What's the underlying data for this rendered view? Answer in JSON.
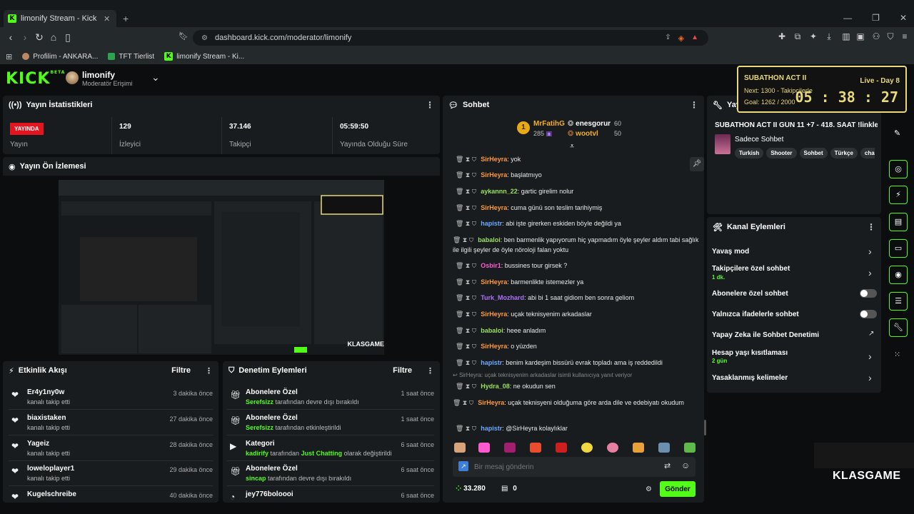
{
  "browser": {
    "tab_title": "limonify Stream - Kick Dashboard",
    "url": "dashboard.kick.com/moderator/limonify",
    "bookmarks": [
      "Profilim - ANKARA...",
      "TFT Tierlist",
      "limonify Stream - Ki..."
    ]
  },
  "header": {
    "logo": "KICK",
    "logo_beta": "BETA",
    "channel_name": "limonify",
    "channel_role": "Moderatör Erişimi"
  },
  "stats": {
    "title": "Yayın İstatistikleri",
    "live_badge": "YAYINDA",
    "items": [
      {
        "value": "",
        "label": "Yayın"
      },
      {
        "value": "129",
        "label": "İzleyici"
      },
      {
        "value": "37.146",
        "label": "Takipçi"
      },
      {
        "value": "05:59:50",
        "label": "Yayında Olduğu Süre"
      }
    ]
  },
  "preview": {
    "title": "Yayın Ön İzlemesi",
    "watermark": "KLASGAME"
  },
  "activity": {
    "title": "Etkinlik Akışı",
    "filter": "Filtre",
    "items": [
      {
        "name": "Er4y1ny0w",
        "sub": "kanalı takip etti",
        "time": "3 dakika önce"
      },
      {
        "name": "biaxistaken",
        "sub": "kanalı takip etti",
        "time": "27 dakika önce"
      },
      {
        "name": "Yageiz",
        "sub": "kanalı takip etti",
        "time": "28 dakika önce"
      },
      {
        "name": "loweloplayer1",
        "sub": "kanalı takip etti",
        "time": "29 dakika önce"
      },
      {
        "name": "Kugelschreibe",
        "sub": "",
        "time": "40 dakika önce"
      }
    ]
  },
  "moderation": {
    "title": "Denetim Eylemleri",
    "filter": "Filtre",
    "items": [
      {
        "name": "Abonelere Özel",
        "actor": "Serefsizz",
        "sub": "tarafından devre dışı bırakıldı",
        "extra": "",
        "tail": "",
        "time": "1 saat önce"
      },
      {
        "name": "Abonelere Özel",
        "actor": "Serefsizz",
        "sub": "tarafından etkinleştirildi",
        "extra": "",
        "tail": "",
        "time": "1 saat önce"
      },
      {
        "name": "Kategori",
        "actor": "kadirify",
        "sub": "tarafından",
        "extra": "Just Chatting",
        "tail": "olarak değiştirildi",
        "time": "6 saat önce"
      },
      {
        "name": "Abonelere Özel",
        "actor": "sincap",
        "sub": "tarafından devre dışı bırakıldı",
        "extra": "",
        "tail": "",
        "time": "6 saat önce"
      },
      {
        "name": "jey776boloooi",
        "actor": "",
        "sub": "",
        "extra": "",
        "tail": "",
        "time": "6 saat önce"
      }
    ]
  },
  "chat": {
    "title": "Sohbet",
    "leader_rank": "1",
    "leader_name": "MrFatihG",
    "leader_score": "285",
    "second_name": "enesgorur",
    "second_score": "60",
    "third_name": "wootvl",
    "third_score": "50",
    "messages": [
      {
        "user": "SirHeyra",
        "color": "#ff9a3c",
        "text": "yok"
      },
      {
        "user": "SirHeyra",
        "color": "#ff9a3c",
        "text": "başlatmıyo"
      },
      {
        "user": "aykannn_22",
        "color": "#9be15d",
        "text": "gartic girelim nolur"
      },
      {
        "user": "SirHeyra",
        "color": "#ff9a3c",
        "text": "cuma günü son teslim tarihiymiş"
      },
      {
        "user": "hapistr",
        "color": "#6aa9ff",
        "text": "abi işte girerken eskiden böyle değildi ya"
      },
      {
        "user": "babaloi",
        "color": "#9be15d",
        "text": "ben barmenlik yapıyorum hiç yapmadım öyle şeyler aldım tabi sağlık ile ilgili şeyler de öyle nöroloji falan yoktu"
      },
      {
        "user": "Osbir1",
        "color": "#ff5ad0",
        "text": "bussines tour girsek ?"
      },
      {
        "user": "SirHeyra",
        "color": "#ff9a3c",
        "text": "barmenlikte istemezler ya"
      },
      {
        "user": "Turk_Mozhard",
        "color": "#b070ff",
        "text": "abi bi 1 saat gidiom ben sonra geliom"
      },
      {
        "user": "SirHeyra",
        "color": "#ff9a3c",
        "text": "uçak teknisyenim arkadaslar"
      },
      {
        "user": "babaloi",
        "color": "#9be15d",
        "text": "heee anladım"
      },
      {
        "user": "SirHeyra",
        "color": "#ff9a3c",
        "text": "o yüzden"
      },
      {
        "user": "hapistr",
        "color": "#6aa9ff",
        "text": "benim kardeşim bissürü evrak topladı ama iş reddedildi"
      },
      {
        "user": "Hydra_08",
        "color": "#9be15d",
        "text": "ne okudun sen"
      },
      {
        "user": "SirHeyra",
        "color": "#ff9a3c",
        "text": "uçak teknisyeni olduğuma göre arda dile ve edebiyatı okudum"
      },
      {
        "user": "hapistr",
        "color": "#6aa9ff",
        "text": "@SirHeyra kolaylıklar"
      }
    ],
    "reply_hint": "SirHeyra: uçak teknisyenim arkadaslar isimli kullanıcıya yanıt veriyor",
    "input_placeholder": "Bir mesaj gönderin",
    "points": "33.280",
    "gifts": "0",
    "send_label": "Gönder"
  },
  "stream_info": {
    "title": "Yayın",
    "stream_title": "SUBATHON ACT II GÜN 11 +7 - 418. SAAT !linkler",
    "chat_mode": "Sadece Sohbet",
    "tags": [
      "Turkish",
      "Shooter",
      "Sohbet",
      "Türkçe",
      "cha"
    ]
  },
  "channel_actions": {
    "title": "Kanal Eylemleri",
    "items": [
      {
        "label": "Yavaş mod",
        "sub": "",
        "kind": "chevron"
      },
      {
        "label": "Takipçilere özel sohbet",
        "sub": "1 dk.",
        "kind": "chevron"
      },
      {
        "label": "Abonelere özel sohbet",
        "sub": "",
        "kind": "toggle"
      },
      {
        "label": "Yalnızca ifadelerle sohbet",
        "sub": "",
        "kind": "toggle"
      },
      {
        "label": "Yapay Zeka ile Sohbet Denetimi",
        "sub": "",
        "kind": "external"
      },
      {
        "label": "Hesap yaşı kısıtlaması",
        "sub": "2 gün",
        "kind": "chevron"
      },
      {
        "label": "Yasaklanmış kelimeler",
        "sub": "",
        "kind": "chevron"
      }
    ]
  },
  "subathon": {
    "title": "SUBATHON ACT II",
    "day": "Live - Day 8",
    "next": "Next: 1300 - Takipcilerle",
    "goal": "Goal: 1262 / 2000",
    "timer": "05 : 38 : 27"
  },
  "watermark": "KLASGAME",
  "colors": {
    "accent": "#53fc18",
    "live": "#e4151e",
    "overlay_border": "#e8d97a"
  }
}
